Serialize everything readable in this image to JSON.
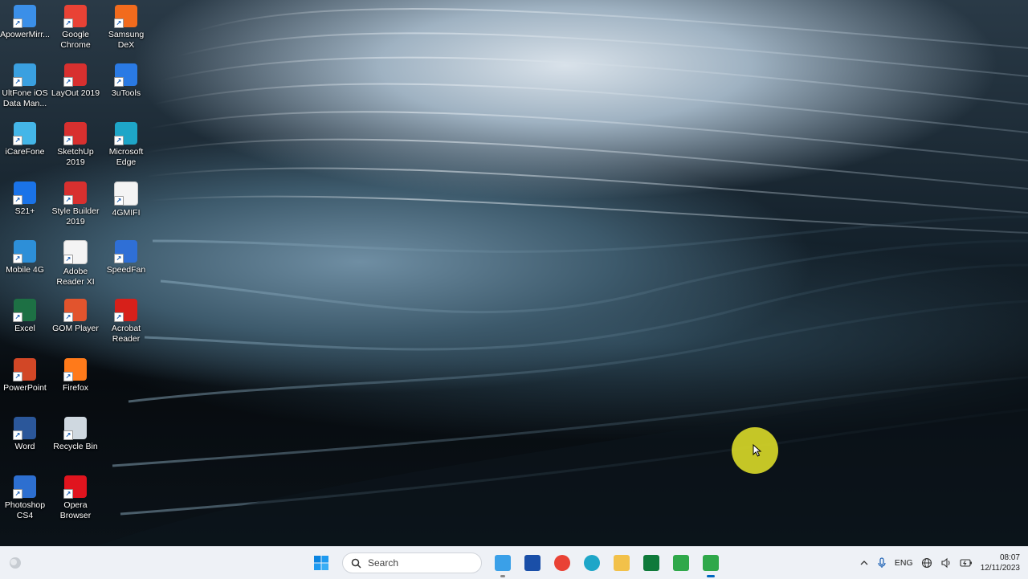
{
  "desktop": {
    "icons": [
      {
        "label": "ApowerMirr...",
        "icon": "apowermirror-icon",
        "color": "#3b8fe8"
      },
      {
        "label": "Google Chrome",
        "icon": "chrome-icon",
        "color": "#e94235"
      },
      {
        "label": "Samsung DeX",
        "icon": "samsung-dex-icon",
        "color": "#f26b1d"
      },
      {
        "label": "UltFone iOS Data Man...",
        "icon": "ultfone-icon",
        "color": "#3aa0e0"
      },
      {
        "label": "LayOut 2019",
        "icon": "layout-icon",
        "color": "#d8302f"
      },
      {
        "label": "3uTools",
        "icon": "3utools-icon",
        "color": "#2a7ae4"
      },
      {
        "label": "iCareFone",
        "icon": "icarefone-icon",
        "color": "#44b6e8"
      },
      {
        "label": "SketchUp 2019",
        "icon": "sketchup-icon",
        "color": "#d8302f"
      },
      {
        "label": "Microsoft Edge",
        "icon": "edge-icon",
        "color": "#1ea6c8"
      },
      {
        "label": "S21+",
        "icon": "s21-icon",
        "color": "#1a73e8"
      },
      {
        "label": "Style Builder 2019",
        "icon": "style-builder-icon",
        "color": "#d8302f"
      },
      {
        "label": "4GMIFI",
        "icon": "file-icon",
        "color": "#f4f4f4"
      },
      {
        "label": "Mobile 4G",
        "icon": "globe-icon",
        "color": "#2d8fd8"
      },
      {
        "label": "Adobe Reader XI",
        "icon": "file-icon",
        "color": "#f4f4f4"
      },
      {
        "label": "SpeedFan",
        "icon": "speedfan-icon",
        "color": "#2f6fd6"
      },
      {
        "label": "Excel",
        "icon": "excel-icon",
        "color": "#1d7044"
      },
      {
        "label": "GOM Player",
        "icon": "gom-player-icon",
        "color": "#e2542d"
      },
      {
        "label": "Acrobat Reader",
        "icon": "acrobat-icon",
        "color": "#d7201a"
      },
      {
        "label": "PowerPoint",
        "icon": "powerpoint-icon",
        "color": "#d24726"
      },
      {
        "label": "Firefox",
        "icon": "firefox-icon",
        "color": "#ff7a1a"
      },
      {
        "label": "Word",
        "icon": "word-icon",
        "color": "#2b579a"
      },
      {
        "label": "Recycle Bin",
        "icon": "recycle-bin-icon",
        "color": "#cfd8e0"
      },
      {
        "label": "Photoshop CS4",
        "icon": "photoshop-icon",
        "color": "#2d6fd0"
      },
      {
        "label": "Opera Browser",
        "icon": "opera-icon",
        "color": "#e0141e"
      }
    ]
  },
  "taskbar": {
    "search_placeholder": "Search",
    "apps": [
      {
        "name": "notepad-taskbar-icon",
        "color": "#3aa0e8",
        "state": "running"
      },
      {
        "name": "store-taskbar-icon",
        "color": "#1a4fa8",
        "state": ""
      },
      {
        "name": "chrome-taskbar-icon",
        "color": "#e94235",
        "state": ""
      },
      {
        "name": "edge-taskbar-icon",
        "color": "#1ea6c8",
        "state": ""
      },
      {
        "name": "file-explorer-taskbar-icon",
        "color": "#f2c14a",
        "state": ""
      },
      {
        "name": "app-green-taskbar-icon",
        "color": "#0f7a3a",
        "state": ""
      },
      {
        "name": "camtasia-taskbar-icon",
        "color": "#2fa84a",
        "state": ""
      },
      {
        "name": "camtasia-recorder-taskbar-icon",
        "color": "#2fa84a",
        "state": "active"
      }
    ],
    "tray": {
      "language": "ENG",
      "time": "08:07",
      "date": "12/11/2023"
    }
  },
  "colors": {
    "taskbar_bg": "#eef1f6",
    "accent": "#0067c0",
    "cursor_halo": "#d6d628"
  }
}
